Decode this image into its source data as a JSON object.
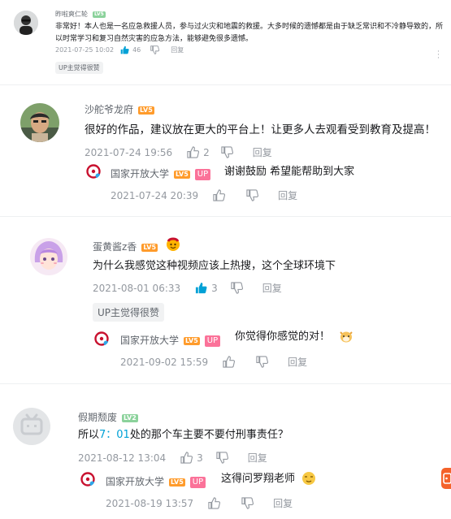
{
  "comments": [
    {
      "user": "昨啦爽仁轮",
      "level": "LV5",
      "text": "非常好！本人也是一名应急救援人员，参与过火灾和地震的救援。大多时候的遗憾都是由于缺乏常识和不冷静导致的，所以时常学习和复习自然灾害的应急方法，能够避免很多遗憾。",
      "time": "2021-07-25 10:02",
      "likes": "46",
      "reply_label": "回复",
      "tag": "UP主觉得很赞"
    },
    {
      "user": "沙舵爷龙府",
      "level": "LV5",
      "text": "很好的作品，建议放在更大的平台上！让更多人去观看受到教育及提高！",
      "time": "2021-07-24 19:56",
      "likes": "2",
      "reply_label": "回复",
      "reply": {
        "user": "国家开放大学",
        "level": "LV5",
        "badge": "UP",
        "text": "谢谢鼓励 希望能帮助到大家",
        "time": "2021-07-24 20:39",
        "reply_label": "回复"
      }
    },
    {
      "user": "蛋黄酱z香",
      "level": "LV5",
      "text": "为什么我感觉这种视频应该上热搜，这个全球环境下",
      "time": "2021-08-01 06:33",
      "likes": "3",
      "reply_label": "回复",
      "tag": "UP主觉得很赞",
      "reply": {
        "user": "国家开放大学",
        "level": "LV5",
        "badge": "UP",
        "text": "你觉得你感觉的对！",
        "time": "2021-09-02 15:59",
        "reply_label": "回复"
      }
    },
    {
      "user": "假期颓废",
      "level": "LV2",
      "text_prefix": "所以",
      "text_link": "7：01",
      "text_suffix": "处的那个车主要不要付刑事责任？",
      "time": "2021-08-12 13:04",
      "likes": "3",
      "reply_label": "回复",
      "reply": {
        "user": "国家开放大学",
        "level": "LV5",
        "badge": "UP",
        "text": "这得问罗翔老师",
        "time": "2021-08-19 13:57",
        "reply_label": "回复"
      }
    }
  ],
  "colors": {
    "lv5": "#ff9b2b",
    "lv2": "#8bd29b",
    "up": "#fb7299",
    "liked": "#00a1d6",
    "meta": "#9499a0"
  },
  "icons": [
    "thumb-up-icon",
    "thumb-down-icon",
    "emoji-icon",
    "float-tab-icon"
  ]
}
